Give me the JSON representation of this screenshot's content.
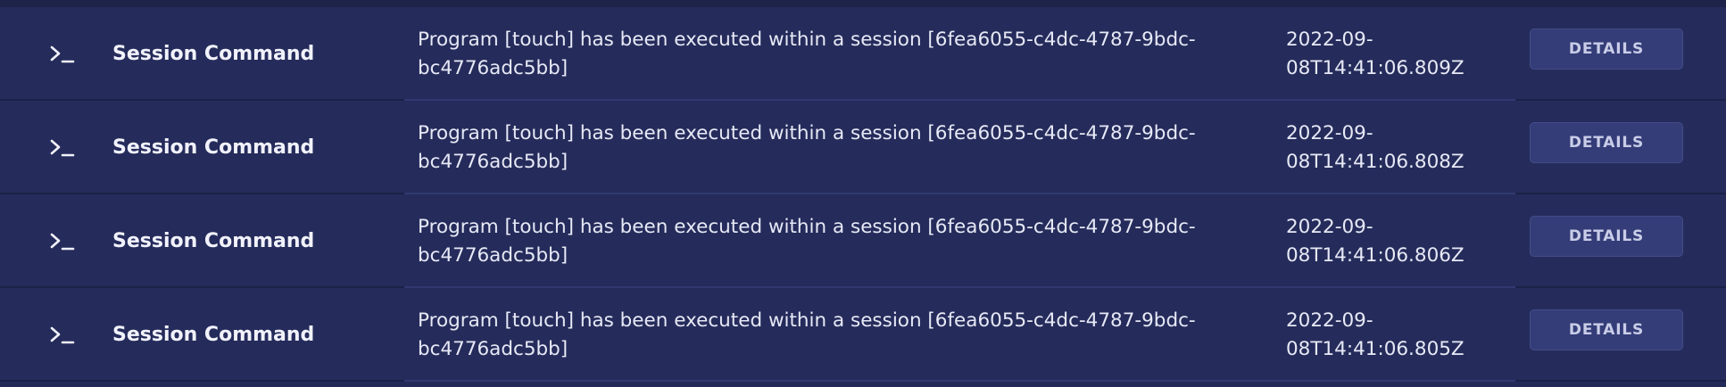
{
  "events": [
    {
      "icon": "terminal-icon",
      "type": "Session Command",
      "message_line1": "Program [touch] has been executed within a session [6fea6055-c4dc-4787-9bdc-",
      "message_line2": "bc4776adc5bb]",
      "timestamp_line1": "2022-09-",
      "timestamp_line2": "08T14:41:06.809Z",
      "action_label": "DETAILS"
    },
    {
      "icon": "terminal-icon",
      "type": "Session Command",
      "message_line1": "Program [touch] has been executed within a session [6fea6055-c4dc-4787-9bdc-",
      "message_line2": "bc4776adc5bb]",
      "timestamp_line1": "2022-09-",
      "timestamp_line2": "08T14:41:06.808Z",
      "action_label": "DETAILS"
    },
    {
      "icon": "terminal-icon",
      "type": "Session Command",
      "message_line1": "Program [touch] has been executed within a session [6fea6055-c4dc-4787-9bdc-",
      "message_line2": "bc4776adc5bb]",
      "timestamp_line1": "2022-09-",
      "timestamp_line2": "08T14:41:06.806Z",
      "action_label": "DETAILS"
    },
    {
      "icon": "terminal-icon",
      "type": "Session Command",
      "message_line1": "Program [touch] has been executed within a session [6fea6055-c4dc-4787-9bdc-",
      "message_line2": "bc4776adc5bb]",
      "timestamp_line1": "2022-09-",
      "timestamp_line2": "08T14:41:06.805Z",
      "action_label": "DETAILS"
    }
  ],
  "colors": {
    "background": "#232a58",
    "row": "#252c5b",
    "button": "#343d78",
    "text": "#e7e9f6"
  }
}
